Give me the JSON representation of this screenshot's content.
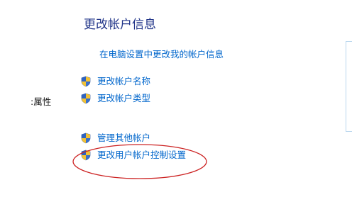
{
  "page": {
    "title": "更改帐户信息"
  },
  "links": {
    "pc_settings": "在电脑设置中更改我的帐户信息"
  },
  "tasks": [
    {
      "label": "更改帐户名称",
      "icon": "uac-shield-icon"
    },
    {
      "label": "更改帐户类型",
      "icon": "uac-shield-icon"
    },
    {
      "label": "管理其他帐户",
      "icon": "uac-shield-icon"
    },
    {
      "label": "更改用户帐户控制设置",
      "icon": "uac-shield-icon"
    }
  ],
  "sidebar": {
    "partial_label": ":属性"
  },
  "colors": {
    "title": "#1e3287",
    "link": "#0066cc",
    "annotation": "#cc2222"
  }
}
